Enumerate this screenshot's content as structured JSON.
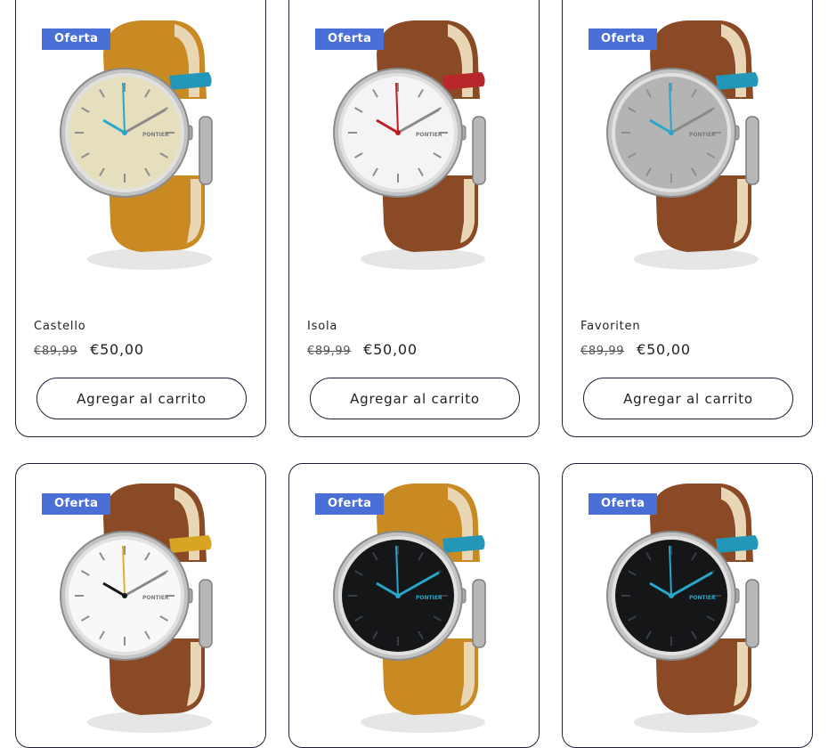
{
  "products": [
    {
      "badge": "Oferta",
      "name": "Castello",
      "price_old": "€89,99",
      "price_new": "€50,00",
      "cart_label": "Agregar al carrito",
      "colors": {
        "strap": "#c98a23",
        "face": "#e5dfbe",
        "accent": "#2aa6c8",
        "loop": "#2496b8"
      }
    },
    {
      "badge": "Oferta",
      "name": "Isola",
      "price_old": "€89,99",
      "price_new": "€50,00",
      "cart_label": "Agregar al carrito",
      "colors": {
        "strap": "#8a4a26",
        "face": "#f4f4f4",
        "accent": "#c01c24",
        "loop": "#b8272a"
      }
    },
    {
      "badge": "Oferta",
      "name": "Favoriten",
      "price_old": "€89,99",
      "price_new": "€50,00",
      "cart_label": "Agregar al carrito",
      "colors": {
        "strap": "#8a4a26",
        "face": "#b4b4b4",
        "accent": "#2aa6c8",
        "loop": "#2496b8"
      }
    },
    {
      "badge": "Oferta",
      "colors": {
        "strap": "#8a4a26",
        "face": "#f8f8f8",
        "accent": "#e0b028",
        "loop": "#d8a424"
      }
    },
    {
      "badge": "Oferta",
      "colors": {
        "strap": "#c98a23",
        "face": "#141618",
        "accent": "#2aa6c8",
        "loop": "#2496b8"
      }
    },
    {
      "badge": "Oferta",
      "colors": {
        "strap": "#8a4a26",
        "face": "#141618",
        "accent": "#2aa6c8",
        "loop": "#2496b8"
      }
    }
  ],
  "brand_mark": "PONTIER"
}
